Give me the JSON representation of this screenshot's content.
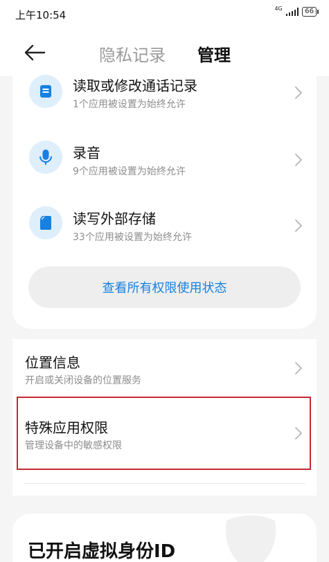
{
  "status_bar": {
    "time": "上午10:54",
    "network": "4G",
    "battery": "66"
  },
  "nav": {
    "tabs": [
      {
        "label": "隐私记录",
        "active": false
      },
      {
        "label": "管理",
        "active": true
      }
    ]
  },
  "permissions": [
    {
      "title": "读取或修改通话记录",
      "subtitle": "1个应用被设置为始终允许",
      "icon": "call-log-icon"
    },
    {
      "title": "录音",
      "subtitle": "9个应用被设置为始终允许",
      "icon": "microphone-icon"
    },
    {
      "title": "读写外部存储",
      "subtitle": "33个应用被设置为始终允许",
      "icon": "storage-icon"
    }
  ],
  "view_all_label": "查看所有权限使用状态",
  "settings": [
    {
      "title": "位置信息",
      "subtitle": "开启或关闭设备的位置服务"
    },
    {
      "title": "特殊应用权限",
      "subtitle": "管理设备中的敏感权限",
      "highlighted": true
    }
  ],
  "bottom_card": {
    "title": "已开启虚拟身份ID"
  },
  "colors": {
    "accent_blue": "#1780e0",
    "icon_bg": "#dfeefb",
    "highlight_red": "#c8252f",
    "page_bg": "#f5f5f5"
  }
}
